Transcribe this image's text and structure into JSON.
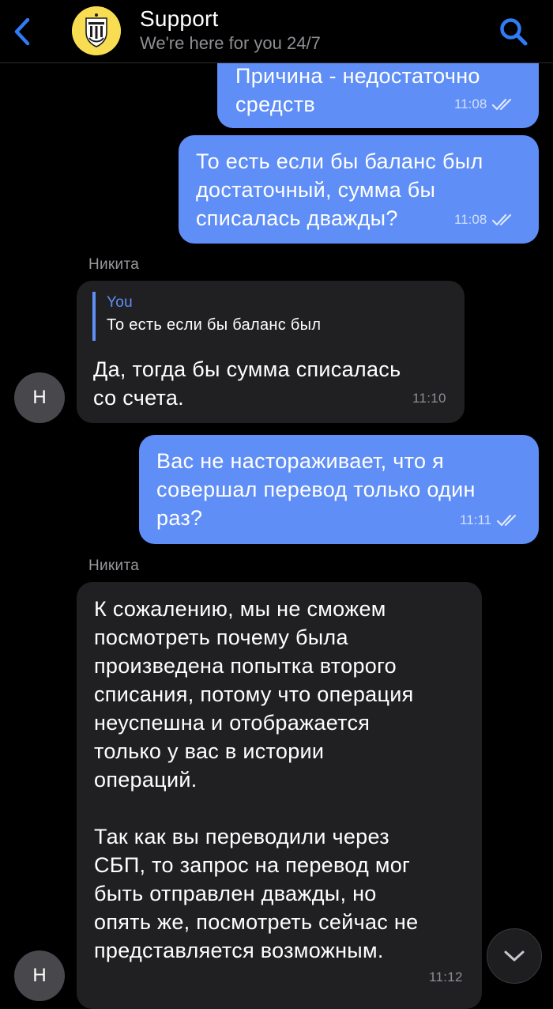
{
  "header": {
    "back_icon": "chevron-left-icon",
    "title": "Support",
    "subtitle": "We're here for you 24/7",
    "search_icon": "search-icon",
    "logo_icon": "tinkoff-shield-logo",
    "accent_color": "#2f7cf6"
  },
  "colors": {
    "outgoing_bubble": "#5f8ef7",
    "incoming_bubble": "#202023",
    "background": "#000000"
  },
  "messages": [
    {
      "direction": "outgoing",
      "text": "Причина - недостаточно\nсредств",
      "time": "11:08",
      "status": "read"
    },
    {
      "direction": "outgoing",
      "text": "То есть если бы баланс был\nдостаточный, сумма бы\nсписалась дважды?",
      "time": "11:08",
      "status": "read"
    },
    {
      "direction": "incoming",
      "sender": "Никита",
      "avatar": "Н",
      "reply": {
        "author": "You",
        "text": "То есть если бы баланс был"
      },
      "text": "Да, тогда бы сумма списалась\nсо счета.",
      "time": "11:10"
    },
    {
      "direction": "outgoing",
      "text": "Вас не настораживает, что я\nсовершал перевод только один\nраз?",
      "time": "11:11",
      "status": "read"
    },
    {
      "direction": "incoming",
      "sender": "Никита",
      "avatar": "Н",
      "text": "К сожалению, мы не сможем\nпосмотреть почему была\nпроизведена попытка второго\nсписания, потому что операция\nнеуспешна и отображается\nтолько у вас в истории\nопераций.\n\nТак как вы переводили через\nСБП, то запрос на перевод мог\nбыть отправлен дважды, но\nопять же, посмотреть сейчас не\nпредставляется возможным.",
      "time": "11:12"
    }
  ],
  "scroll_down_icon": "chevron-down-icon"
}
